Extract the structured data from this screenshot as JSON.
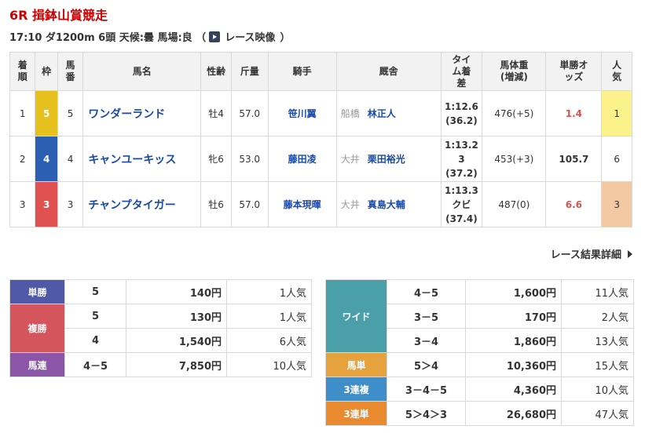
{
  "race": {
    "title": "6R 揖鉢山賞競走",
    "info": "17:10 ダ1200m 6頭 天候:曇 馬場:良 （",
    "video": "レース映像",
    "info_close": "）"
  },
  "headers": {
    "rank": "着順",
    "waku": "枠",
    "num": "馬番",
    "name": "馬名",
    "sexage": "性齢",
    "weight": "斤量",
    "jockey": "騎手",
    "stable": "厩舎",
    "time": "タイム着差",
    "body": "馬体重(増減)",
    "odds": "単勝オッズ",
    "pop": "人気"
  },
  "rows": [
    {
      "rank": "1",
      "waku": "5",
      "waku_color": "#e6c01c",
      "num": "5",
      "name": "ワンダーランド",
      "sexage": "牡4",
      "weight": "57.0",
      "jockey": "笹川翼",
      "area": "船橋",
      "trainer": "林正人",
      "time": "1:12.6",
      "margin": "(36.2)",
      "body": "476(+5)",
      "odds": "1.4",
      "odds_red": true,
      "pop": "1",
      "pop_color": "#fbf28b"
    },
    {
      "rank": "2",
      "waku": "4",
      "waku_color": "#2b5fb3",
      "num": "4",
      "name": "キャンユーキッス",
      "sexage": "牝6",
      "weight": "53.0",
      "jockey": "藤田凌",
      "area": "大井",
      "trainer": "栗田裕光",
      "time": "1:13.2",
      "margin": "3",
      "margin2": "(37.2)",
      "body": "453(+3)",
      "odds": "105.7",
      "odds_red": false,
      "pop": "6",
      "pop_color": "#ffffff"
    },
    {
      "rank": "3",
      "waku": "3",
      "waku_color": "#e05252",
      "num": "3",
      "name": "チャンプタイガー",
      "sexage": "牡6",
      "weight": "57.0",
      "jockey": "藤本現暉",
      "area": "大井",
      "trainer": "真島大輔",
      "time": "1:13.3",
      "margin": "クビ",
      "margin2": "(37.4)",
      "body": "487(0)",
      "odds": "6.6",
      "odds_red": true,
      "pop": "3",
      "pop_color": "#f2c9a3"
    }
  ],
  "detail_link": "レース結果詳細",
  "payout_left": [
    {
      "label": "単勝",
      "color": "#5059a8",
      "lines": [
        {
          "combo": "5",
          "amount": "140円",
          "pop": "1人気"
        }
      ]
    },
    {
      "label": "複勝",
      "color": "#d5555d",
      "lines": [
        {
          "combo": "5",
          "amount": "130円",
          "pop": "1人気"
        },
        {
          "combo": "4",
          "amount": "1,540円",
          "pop": "6人気"
        }
      ]
    },
    {
      "label": "馬連",
      "color": "#8c56a8",
      "lines": [
        {
          "combo": "4－5",
          "amount": "7,850円",
          "pop": "10人気"
        }
      ]
    }
  ],
  "payout_right": [
    {
      "label": "ワイド",
      "color": "#4a9fa8",
      "lines": [
        {
          "combo": "4－5",
          "amount": "1,600円",
          "pop": "11人気"
        },
        {
          "combo": "3－5",
          "amount": "170円",
          "pop": "2人気"
        },
        {
          "combo": "3－4",
          "amount": "1,860円",
          "pop": "13人気"
        }
      ]
    },
    {
      "label": "馬単",
      "color": "#e6a23c",
      "lines": [
        {
          "combo": "5＞4",
          "amount": "10,360円",
          "pop": "15人気"
        }
      ]
    },
    {
      "label": "3連複",
      "color": "#3e8fc9",
      "lines": [
        {
          "combo": "3－4－5",
          "amount": "4,360円",
          "pop": "10人気"
        }
      ]
    },
    {
      "label": "3連単",
      "color": "#ea8a2e",
      "lines": [
        {
          "combo": "5＞4＞3",
          "amount": "26,680円",
          "pop": "47人気"
        }
      ]
    }
  ]
}
